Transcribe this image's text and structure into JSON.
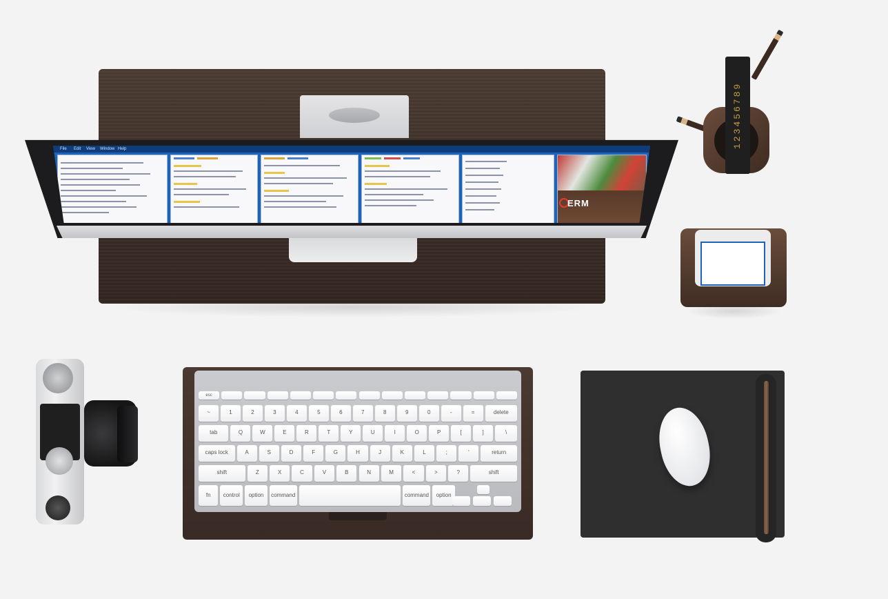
{
  "scene": {
    "monitor": {
      "apple_logo": "",
      "menubar_items": [
        "File",
        "Edit",
        "View",
        "Window",
        "Help"
      ],
      "brand_logo_text": "ERM"
    },
    "ruler": {
      "numbers": "123456789"
    },
    "keyboard": {
      "function_row": [
        "esc",
        "",
        "",
        "",
        "",
        "",
        "",
        "",
        "",
        "",
        "",
        "",
        "",
        ""
      ],
      "number_row": [
        "~",
        "1",
        "2",
        "3",
        "4",
        "5",
        "6",
        "7",
        "8",
        "9",
        "0",
        "-",
        "=",
        "delete"
      ],
      "top_row": [
        "tab",
        "Q",
        "W",
        "E",
        "R",
        "T",
        "Y",
        "U",
        "I",
        "O",
        "P",
        "[",
        "]",
        "\\"
      ],
      "home_row": [
        "caps lock",
        "A",
        "S",
        "D",
        "F",
        "G",
        "H",
        "J",
        "K",
        "L",
        ";",
        "'",
        "return"
      ],
      "bottom_row": [
        "shift",
        "Z",
        "X",
        "C",
        "V",
        "B",
        "N",
        "M",
        "<",
        ">",
        "?",
        "shift"
      ],
      "space_row": [
        "fn",
        "control",
        "option",
        "command",
        "",
        "command",
        "option"
      ]
    },
    "mouse": {
      "logo": ""
    },
    "colors": {
      "background": "#f3f3f3",
      "desk_wood": "#3f3029",
      "screen_accent": "#1e63b8",
      "mouse_pad": "#2f2f30"
    }
  }
}
